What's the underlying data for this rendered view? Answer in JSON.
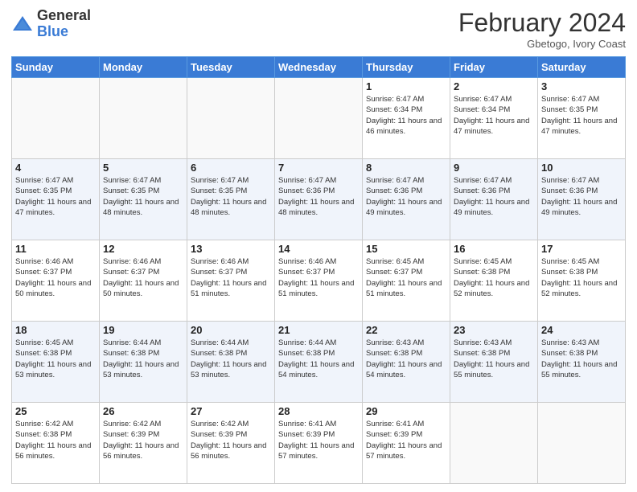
{
  "logo": {
    "general": "General",
    "blue": "Blue"
  },
  "header": {
    "month": "February 2024",
    "location": "Gbetogo, Ivory Coast"
  },
  "days_of_week": [
    "Sunday",
    "Monday",
    "Tuesday",
    "Wednesday",
    "Thursday",
    "Friday",
    "Saturday"
  ],
  "weeks": [
    [
      {
        "day": "",
        "info": ""
      },
      {
        "day": "",
        "info": ""
      },
      {
        "day": "",
        "info": ""
      },
      {
        "day": "",
        "info": ""
      },
      {
        "day": "1",
        "info": "Sunrise: 6:47 AM\nSunset: 6:34 PM\nDaylight: 11 hours and 46 minutes."
      },
      {
        "day": "2",
        "info": "Sunrise: 6:47 AM\nSunset: 6:34 PM\nDaylight: 11 hours and 47 minutes."
      },
      {
        "day": "3",
        "info": "Sunrise: 6:47 AM\nSunset: 6:35 PM\nDaylight: 11 hours and 47 minutes."
      }
    ],
    [
      {
        "day": "4",
        "info": "Sunrise: 6:47 AM\nSunset: 6:35 PM\nDaylight: 11 hours and 47 minutes."
      },
      {
        "day": "5",
        "info": "Sunrise: 6:47 AM\nSunset: 6:35 PM\nDaylight: 11 hours and 48 minutes."
      },
      {
        "day": "6",
        "info": "Sunrise: 6:47 AM\nSunset: 6:35 PM\nDaylight: 11 hours and 48 minutes."
      },
      {
        "day": "7",
        "info": "Sunrise: 6:47 AM\nSunset: 6:36 PM\nDaylight: 11 hours and 48 minutes."
      },
      {
        "day": "8",
        "info": "Sunrise: 6:47 AM\nSunset: 6:36 PM\nDaylight: 11 hours and 49 minutes."
      },
      {
        "day": "9",
        "info": "Sunrise: 6:47 AM\nSunset: 6:36 PM\nDaylight: 11 hours and 49 minutes."
      },
      {
        "day": "10",
        "info": "Sunrise: 6:47 AM\nSunset: 6:36 PM\nDaylight: 11 hours and 49 minutes."
      }
    ],
    [
      {
        "day": "11",
        "info": "Sunrise: 6:46 AM\nSunset: 6:37 PM\nDaylight: 11 hours and 50 minutes."
      },
      {
        "day": "12",
        "info": "Sunrise: 6:46 AM\nSunset: 6:37 PM\nDaylight: 11 hours and 50 minutes."
      },
      {
        "day": "13",
        "info": "Sunrise: 6:46 AM\nSunset: 6:37 PM\nDaylight: 11 hours and 51 minutes."
      },
      {
        "day": "14",
        "info": "Sunrise: 6:46 AM\nSunset: 6:37 PM\nDaylight: 11 hours and 51 minutes."
      },
      {
        "day": "15",
        "info": "Sunrise: 6:45 AM\nSunset: 6:37 PM\nDaylight: 11 hours and 51 minutes."
      },
      {
        "day": "16",
        "info": "Sunrise: 6:45 AM\nSunset: 6:38 PM\nDaylight: 11 hours and 52 minutes."
      },
      {
        "day": "17",
        "info": "Sunrise: 6:45 AM\nSunset: 6:38 PM\nDaylight: 11 hours and 52 minutes."
      }
    ],
    [
      {
        "day": "18",
        "info": "Sunrise: 6:45 AM\nSunset: 6:38 PM\nDaylight: 11 hours and 53 minutes."
      },
      {
        "day": "19",
        "info": "Sunrise: 6:44 AM\nSunset: 6:38 PM\nDaylight: 11 hours and 53 minutes."
      },
      {
        "day": "20",
        "info": "Sunrise: 6:44 AM\nSunset: 6:38 PM\nDaylight: 11 hours and 53 minutes."
      },
      {
        "day": "21",
        "info": "Sunrise: 6:44 AM\nSunset: 6:38 PM\nDaylight: 11 hours and 54 minutes."
      },
      {
        "day": "22",
        "info": "Sunrise: 6:43 AM\nSunset: 6:38 PM\nDaylight: 11 hours and 54 minutes."
      },
      {
        "day": "23",
        "info": "Sunrise: 6:43 AM\nSunset: 6:38 PM\nDaylight: 11 hours and 55 minutes."
      },
      {
        "day": "24",
        "info": "Sunrise: 6:43 AM\nSunset: 6:38 PM\nDaylight: 11 hours and 55 minutes."
      }
    ],
    [
      {
        "day": "25",
        "info": "Sunrise: 6:42 AM\nSunset: 6:38 PM\nDaylight: 11 hours and 56 minutes."
      },
      {
        "day": "26",
        "info": "Sunrise: 6:42 AM\nSunset: 6:39 PM\nDaylight: 11 hours and 56 minutes."
      },
      {
        "day": "27",
        "info": "Sunrise: 6:42 AM\nSunset: 6:39 PM\nDaylight: 11 hours and 56 minutes."
      },
      {
        "day": "28",
        "info": "Sunrise: 6:41 AM\nSunset: 6:39 PM\nDaylight: 11 hours and 57 minutes."
      },
      {
        "day": "29",
        "info": "Sunrise: 6:41 AM\nSunset: 6:39 PM\nDaylight: 11 hours and 57 minutes."
      },
      {
        "day": "",
        "info": ""
      },
      {
        "day": "",
        "info": ""
      }
    ]
  ]
}
